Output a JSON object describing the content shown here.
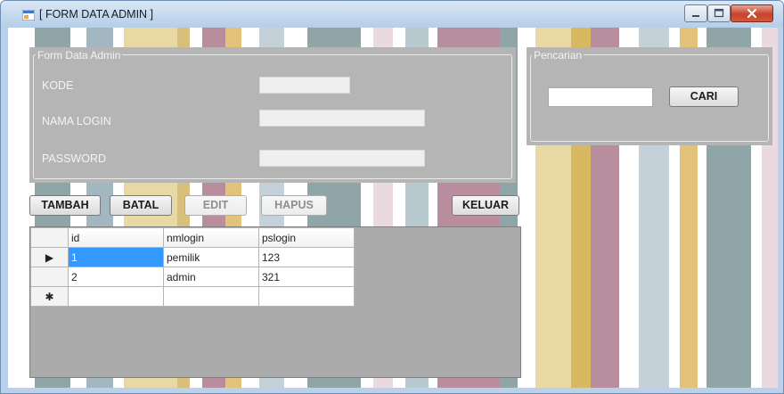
{
  "window": {
    "title": "[ FORM DATA ADMIN ]"
  },
  "form_group": {
    "title": "Form Data Admin",
    "fields": [
      {
        "label": "KODE",
        "value": ""
      },
      {
        "label": "NAMA LOGIN",
        "value": ""
      },
      {
        "label": "PASSWORD",
        "value": ""
      }
    ]
  },
  "search_group": {
    "title": "Pencarian",
    "input_value": "",
    "button_label": "CARI"
  },
  "buttons": {
    "tambah": "TAMBAH",
    "batal": "BATAL",
    "edit": "EDIT",
    "hapus": "HAPUS",
    "keluar": "KELUAR"
  },
  "grid": {
    "columns": [
      "id",
      "nmlogin",
      "pslogin"
    ],
    "rows": [
      {
        "indicator": "▶",
        "cells": [
          "1",
          "pemilik",
          "123"
        ]
      },
      {
        "indicator": "",
        "cells": [
          "2",
          "admin",
          "321"
        ]
      },
      {
        "indicator": "✱",
        "cells": [
          "",
          "",
          ""
        ]
      }
    ]
  },
  "colors": {
    "titlebar": "#c4d8ee",
    "panel_gray": "#b5b5b5",
    "selection_blue": "#3399ff",
    "close_red": "#c7422b"
  }
}
